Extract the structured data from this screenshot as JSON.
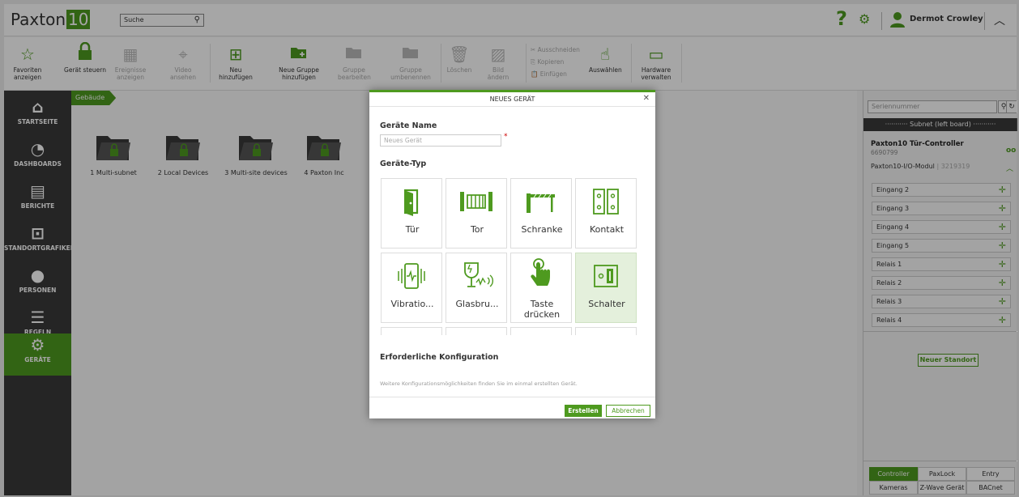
{
  "header": {
    "logo_text": "Paxton",
    "logo_num": "10",
    "search_placeholder": "Suche",
    "user_name": "Dermot Crowley"
  },
  "ribbon": {
    "items": [
      {
        "label": "Favoriten anzeigen",
        "icon": "star-icon",
        "disabled": false
      },
      {
        "label": "Gerät steuern",
        "icon": "lock-icon",
        "disabled": false
      },
      {
        "label": "Ereignisse anzeigen",
        "icon": "events-icon",
        "disabled": true
      },
      {
        "label": "Video ansehen",
        "icon": "camera-icon",
        "disabled": true
      },
      {
        "label": "Neu hinzufügen",
        "icon": "add-new-icon",
        "disabled": false
      },
      {
        "label": "Neue Gruppe hinzufügen",
        "icon": "add-group-icon",
        "disabled": false
      },
      {
        "label": "Gruppe bearbeiten",
        "icon": "edit-group-icon",
        "disabled": true
      },
      {
        "label": "Gruppe umbenennen",
        "icon": "rename-group-icon",
        "disabled": true
      },
      {
        "label": "Löschen",
        "icon": "trash-icon",
        "disabled": true
      },
      {
        "label": "Bild ändern",
        "icon": "image-icon",
        "disabled": true
      },
      {
        "label": "Auswählen",
        "icon": "select-icon",
        "disabled": false
      },
      {
        "label": "Hardware verwalten",
        "icon": "hardware-icon",
        "disabled": false
      }
    ],
    "clipboard": {
      "cut": "Ausschneiden",
      "copy": "Kopieren",
      "paste": "Einfügen"
    }
  },
  "sidebar": {
    "items": [
      {
        "label": "STARTSEITE",
        "icon": "home-icon"
      },
      {
        "label": "DASHBOARDS",
        "icon": "dashboard-icon"
      },
      {
        "label": "BERICHTE",
        "icon": "reports-icon"
      },
      {
        "label": "STANDORTGRAFIKEN",
        "icon": "floorplan-icon"
      },
      {
        "label": "PERSONEN",
        "icon": "person-icon"
      },
      {
        "label": "REGELN",
        "icon": "rules-icon"
      },
      {
        "label": "GERÄTE",
        "icon": "devices-icon",
        "active": true
      }
    ]
  },
  "main": {
    "breadcrumb": "Gebäude",
    "folders": [
      "1 Multi-subnet",
      "2 Local Devices",
      "3 Multi-site devices",
      "4 Paxton Inc"
    ]
  },
  "right_panel": {
    "serial_placeholder": "Seriennummer",
    "subnet_label": "Subnet (left board)",
    "controller_title": "Paxton10 Tür-Controller",
    "controller_serial": "6690799",
    "module_name": "Paxton10-I/O-Modul",
    "module_serial": "3219319",
    "io_items": [
      "Eingang 2",
      "Eingang 3",
      "Eingang 4",
      "Eingang 5",
      "Relais 1",
      "Relais 2",
      "Relais 3",
      "Relais 4"
    ],
    "new_site": "Neuer Standort",
    "tabs": [
      {
        "label": "Controller",
        "active": true
      },
      {
        "label": "PaxLock",
        "active": false
      },
      {
        "label": "Entry",
        "active": false
      },
      {
        "label": "Kameras",
        "active": false
      },
      {
        "label": "Z-Wave Gerät",
        "active": false
      },
      {
        "label": "BACnet",
        "active": false
      }
    ]
  },
  "modal": {
    "title": "NEUES GERÄT",
    "name_label": "Geräte Name",
    "name_placeholder": "Neues Gerät",
    "type_label": "Geräte-Typ",
    "types": [
      {
        "label": "Tür",
        "icon": "door-icon"
      },
      {
        "label": "Tor",
        "icon": "gate-icon"
      },
      {
        "label": "Schranke",
        "icon": "barrier-icon"
      },
      {
        "label": "Kontakt",
        "icon": "contact-icon"
      },
      {
        "label": "Vibratio...",
        "icon": "vibration-icon"
      },
      {
        "label": "Glasbru...",
        "icon": "glassbreak-icon"
      },
      {
        "label": "Taste drücken",
        "icon": "push-button-icon"
      },
      {
        "label": "Schalter",
        "icon": "switch-icon",
        "selected": true
      }
    ],
    "config_label": "Erforderliche Konfiguration",
    "config_note": "Weitere Konfigurationsmöglichkeiten finden Sie im einmal erstellten Gerät.",
    "create_button": "Erstellen",
    "cancel_button": "Abbrechen"
  },
  "colors": {
    "accent": "#4e9a1f",
    "sidebar": "#3a3a3a"
  }
}
